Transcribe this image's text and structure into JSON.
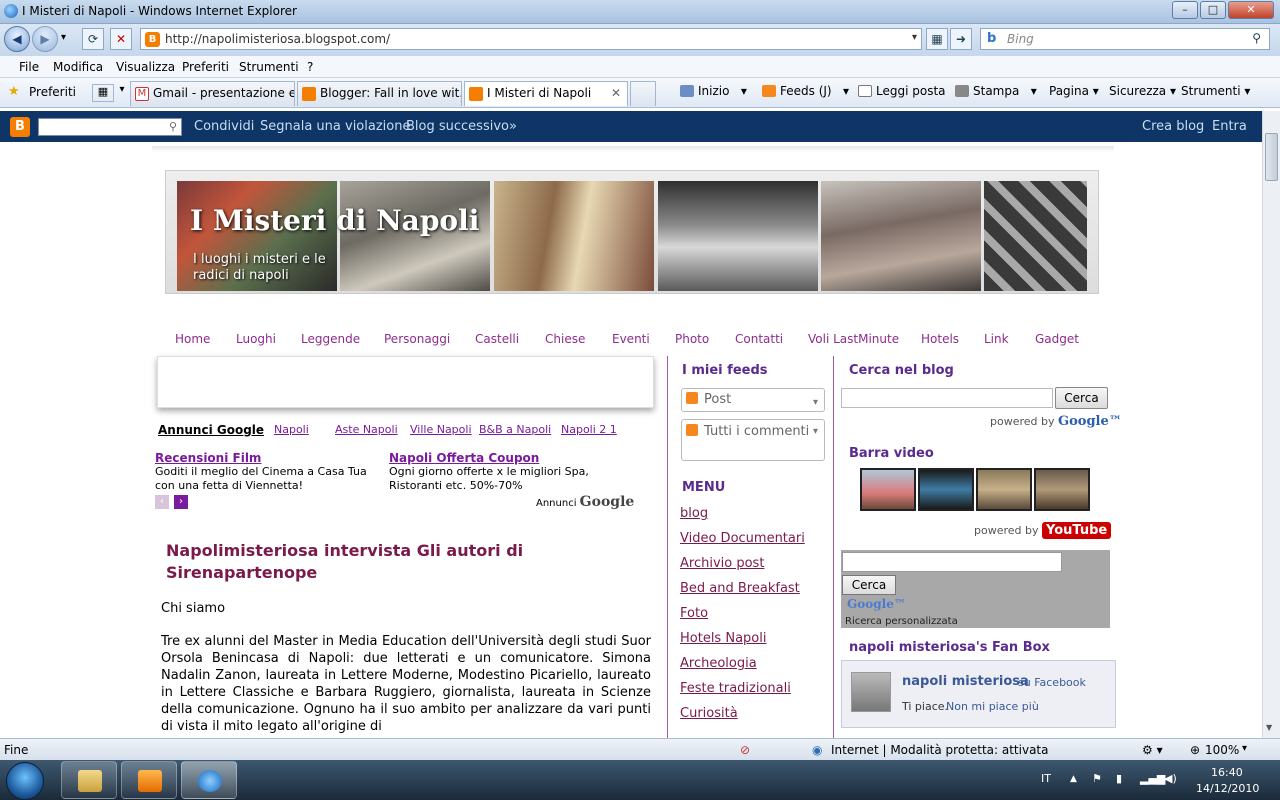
{
  "window": {
    "title": "I Misteri di Napoli - Windows Internet Explorer",
    "minimize": "–",
    "maximize": "□",
    "close": "✕"
  },
  "address": {
    "url": "http://napolimisteriosa.blogspot.com/",
    "search_placeholder": "Bing"
  },
  "menu": [
    "File",
    "Modifica",
    "Visualizza",
    "Preferiti",
    "Strumenti",
    "?"
  ],
  "favorites_label": "Preferiti",
  "tabs": [
    {
      "label": "Gmail - presentazione e ...",
      "color": "#ffffff"
    },
    {
      "label": "Blogger: Fall in love wit...",
      "color": "#f57d00"
    },
    {
      "label": "I Misteri di Napoli",
      "color": "#f57d00"
    }
  ],
  "commands": [
    "Inizio",
    "Feeds (J)",
    "Leggi posta",
    "Stampa",
    "Pagina",
    "Sicurezza",
    "Strumenti"
  ],
  "blogger_nav": {
    "links": [
      "Condividi",
      "Segnala una violazione",
      "Blog successivo»"
    ],
    "right": [
      "Crea blog",
      "Entra"
    ]
  },
  "blog": {
    "title": "I Misteri di Napoli",
    "description": "I luoghi i misteri e le radici di napoli",
    "nav": [
      "Home",
      "Luoghi",
      "Leggende",
      "Personaggi",
      "Castelli",
      "Chiese",
      "Eventi",
      "Photo",
      "Contatti",
      "Voli LastMinute",
      "Hotels",
      "Link",
      "Gadget"
    ]
  },
  "ads": {
    "label": "Annunci Google",
    "links": [
      "Napoli",
      "Aste Napoli",
      "Ville Napoli",
      "B&B a Napoli",
      "Napoli 2 1"
    ],
    "items": [
      {
        "title": "Recensioni Film",
        "desc": "Goditi il meglio del Cinema a Casa Tua con una fetta di Viennetta!"
      },
      {
        "title": "Napoli Offerta Coupon",
        "desc": "Ogni giorno offerte x le migliori Spa, Ristoranti etc. 50%-70%"
      }
    ],
    "by_prefix": "Annunci",
    "by_brand": "Google"
  },
  "post": {
    "title": "Napolimisteriosa intervista Gli autori di Sirenapartenope",
    "intro": "Chi siamo",
    "body": "Tre ex alunni del Master in Media Education dell'Università degli studi Suor Orsola Benincasa di Napoli: due letterati e un comunicatore. Simona Nadalin Zanon, laureata in Lettere Moderne, Modestino Picariello, laureato in Lettere Classiche e Barbara Ruggiero, giornalista, laureata in Scienze della comunicazione. Ognuno ha il suo ambito per analizzare da vari punti di vista il mito legato all'origine di"
  },
  "sidebar_mid": {
    "feeds_title": "I miei feeds",
    "feed_post": "Post",
    "feed_comments": "Tutti i commenti",
    "menu_title": "MENU",
    "menu_items": [
      "blog",
      "Video Documentari",
      "Archivio post",
      "Bed and Breakfast",
      "Foto",
      "Hotels Napoli",
      "Archeologia",
      "Feste tradizionali",
      "Curiosità"
    ]
  },
  "sidebar_right": {
    "search_title": "Cerca nel blog",
    "search_button": "Cerca",
    "powered_by": "powered by",
    "google": "Google™",
    "video_title": "Barra video",
    "youtube": "YouTube",
    "gsearch_button": "Cerca",
    "gsearch_logo": "Google™",
    "gsearch_label": "Ricerca personalizzata",
    "fanbox_title": "napoli misteriosa's Fan Box",
    "fan_name": "napoli misteriosa",
    "fan_on": "su Facebook",
    "fan_like": "Ti piace.",
    "fan_unlike": "Non mi piace più"
  },
  "status": {
    "left": "Fine",
    "zone": "Internet | Modalità protetta: attivata",
    "zoom": "100%"
  },
  "taskbar": {
    "lang": "IT",
    "time": "16:40",
    "date": "14/12/2010"
  },
  "colors": {
    "accent_purple": "#7a1a9c",
    "navbar": "#0e3566",
    "blogger_orange": "#f57d00"
  }
}
